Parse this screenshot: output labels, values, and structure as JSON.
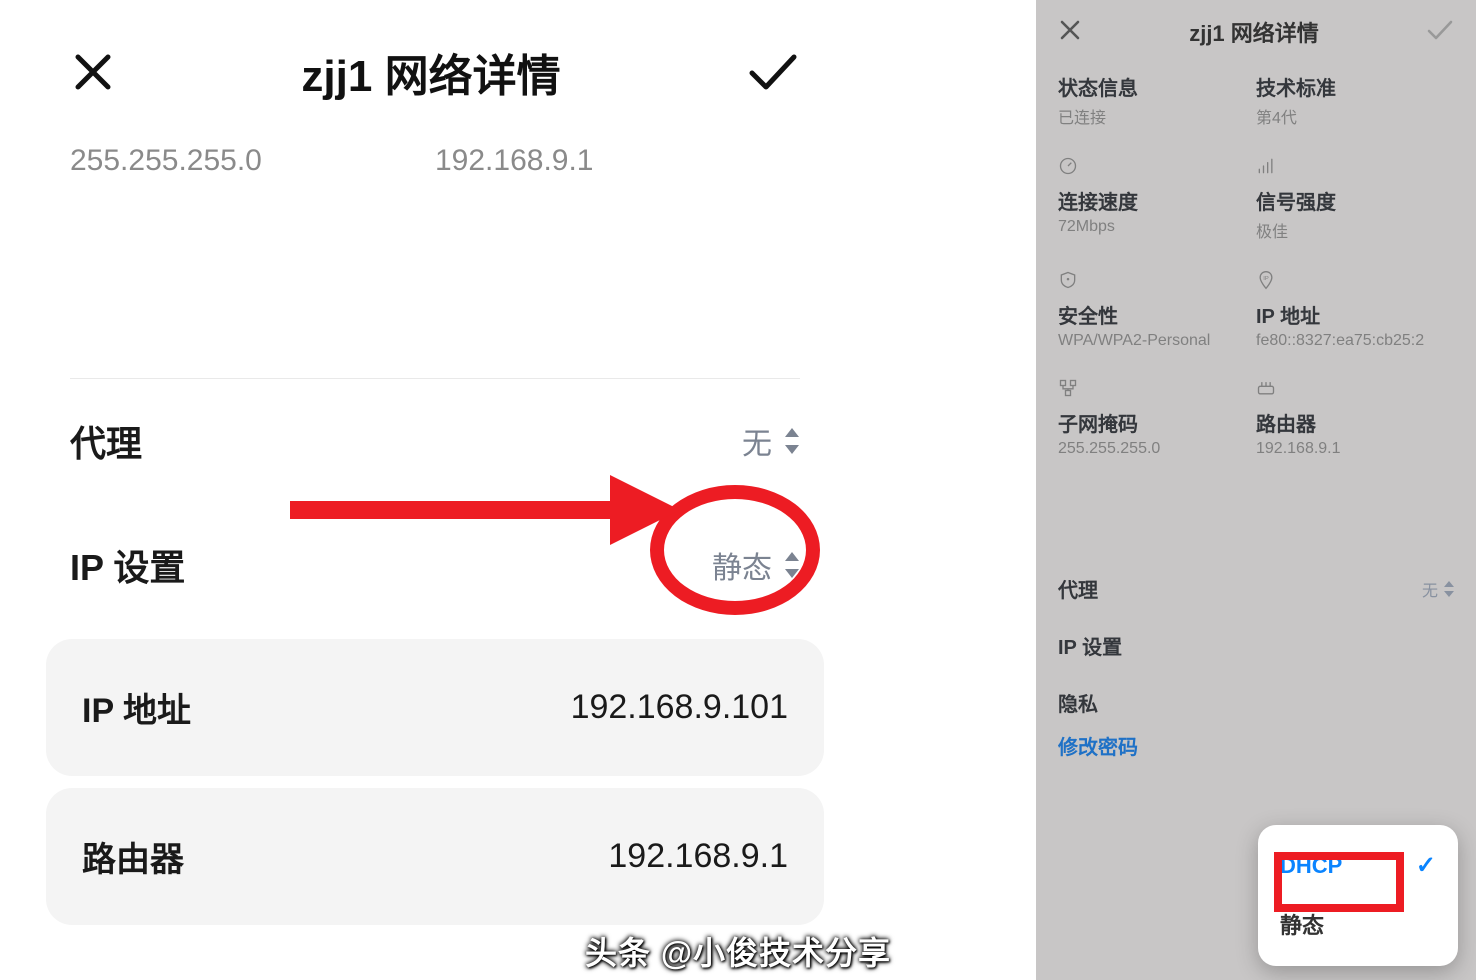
{
  "left": {
    "title": "zjj1 网络详情",
    "subnet_mask": "255.255.255.0",
    "gateway": "192.168.9.1",
    "proxy_label": "代理",
    "proxy_value": "无",
    "ip_settings_label": "IP 设置",
    "ip_settings_value": "静态",
    "ip_address_label": "IP 地址",
    "ip_address_value": "192.168.9.101",
    "router_label": "路由器",
    "router_value": "192.168.9.1"
  },
  "right": {
    "title": "zjj1 网络详情",
    "grid": [
      {
        "label": "状态信息",
        "value": "已连接"
      },
      {
        "label": "技术标准",
        "value": "第4代"
      },
      {
        "label": "连接速度",
        "value": "72Mbps"
      },
      {
        "label": "信号强度",
        "value": "极佳"
      },
      {
        "label": "安全性",
        "value": "WPA/WPA2-Personal"
      },
      {
        "label": "IP 地址",
        "value": "fe80::8327:ea75:cb25:2"
      },
      {
        "label": "子网掩码",
        "value": "255.255.255.0"
      },
      {
        "label": "路由器",
        "value": "192.168.9.1"
      }
    ],
    "proxy_label": "代理",
    "proxy_value": "无",
    "ip_settings_label": "IP 设置",
    "privacy_label": "隐私",
    "change_pwd": "修改密码",
    "popup": {
      "dhcp": "DHCP",
      "static": "静态"
    }
  },
  "watermark": "头条 @小俊技术分享"
}
